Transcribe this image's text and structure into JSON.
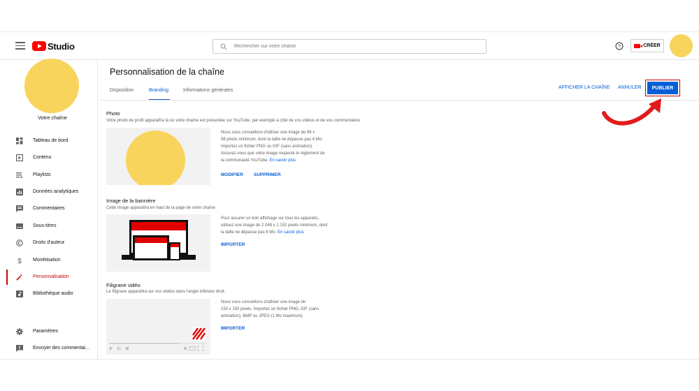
{
  "header": {
    "logo_text": "Studio",
    "search_placeholder": "Rechercher sur votre chaîne",
    "create_label": "CRÉER"
  },
  "sidebar": {
    "channel_label": "Votre chaîne",
    "items": [
      {
        "label": "Tableau de bord",
        "icon": "dashboard-icon"
      },
      {
        "label": "Contenu",
        "icon": "content-icon"
      },
      {
        "label": "Playlists",
        "icon": "playlists-icon"
      },
      {
        "label": "Données analytiques",
        "icon": "analytics-icon"
      },
      {
        "label": "Commentaires",
        "icon": "comments-icon"
      },
      {
        "label": "Sous-titres",
        "icon": "subtitles-icon"
      },
      {
        "label": "Droits d'auteur",
        "icon": "copyright-icon"
      },
      {
        "label": "Monétisation",
        "icon": "dollar-icon"
      },
      {
        "label": "Personnalisation",
        "icon": "magic-wand-icon",
        "active": true
      },
      {
        "label": "Bibliothèque audio",
        "icon": "audio-library-icon"
      }
    ],
    "bottom_items": [
      {
        "label": "Paramètres",
        "icon": "gear-icon"
      },
      {
        "label": "Envoyer des commentai...",
        "icon": "feedback-icon"
      }
    ]
  },
  "main": {
    "title": "Personnalisation de la chaîne",
    "tabs": [
      {
        "label": "Disposition"
      },
      {
        "label": "Branding",
        "active": true
      },
      {
        "label": "Informations générales"
      }
    ],
    "view_channel_label": "AFFICHER LA CHAÎNE",
    "cancel_label": "ANNULER",
    "publish_label": "PUBLIER",
    "photo": {
      "title": "Photo",
      "description": "Votre photo de profil apparaîtra là où votre chaîne est présentée sur YouTube, par exemple à côté de vos vidéos et de vos commentaires",
      "info_lines": [
        "Nous vous conseillons d'utiliser une image de 98 x",
        "98 pixels minimum, dont la taille ne dépasse pas 4 Mo.",
        "Importez un fichier PNG ou GIF (sans animation).",
        "Assurez-vous que votre image respecte le règlement de"
      ],
      "info_last_line": "la communauté YouTube.",
      "learn_more": "En savoir plus",
      "modify_label": "MODIFIER",
      "delete_label": "SUPPRIMER"
    },
    "banner": {
      "title": "Image de la bannière",
      "description": "Cette image apparaîtra en haut de la page de votre chaîne",
      "info_lines": [
        "Pour assurer un bon affichage sur tous les appareils,",
        "utilisez une image de 2 048 x 1 152 pixels minimum, dont"
      ],
      "info_last_line": "la taille ne dépasse pas 6 Mo.",
      "learn_more": "En savoir plus",
      "import_label": "IMPORTER"
    },
    "watermark": {
      "title": "Filigrane vidéo",
      "description": "Le filigrane apparaîtra sur vos vidéos dans l'angle inférieur droit.",
      "info_lines": [
        "Nous vous conseillons d'utiliser une image de",
        "150 x 150 pixels. Importez un fichier PNG, GIF (sans",
        "animation), BMP ou JPEG (1 Mo maximum)."
      ],
      "import_label": "IMPORTER"
    }
  },
  "colors": {
    "accent_blue": "#065fd4",
    "brand_red": "#ff0000",
    "active_red": "#cc0000",
    "avatar_yellow": "#f9d45c"
  }
}
